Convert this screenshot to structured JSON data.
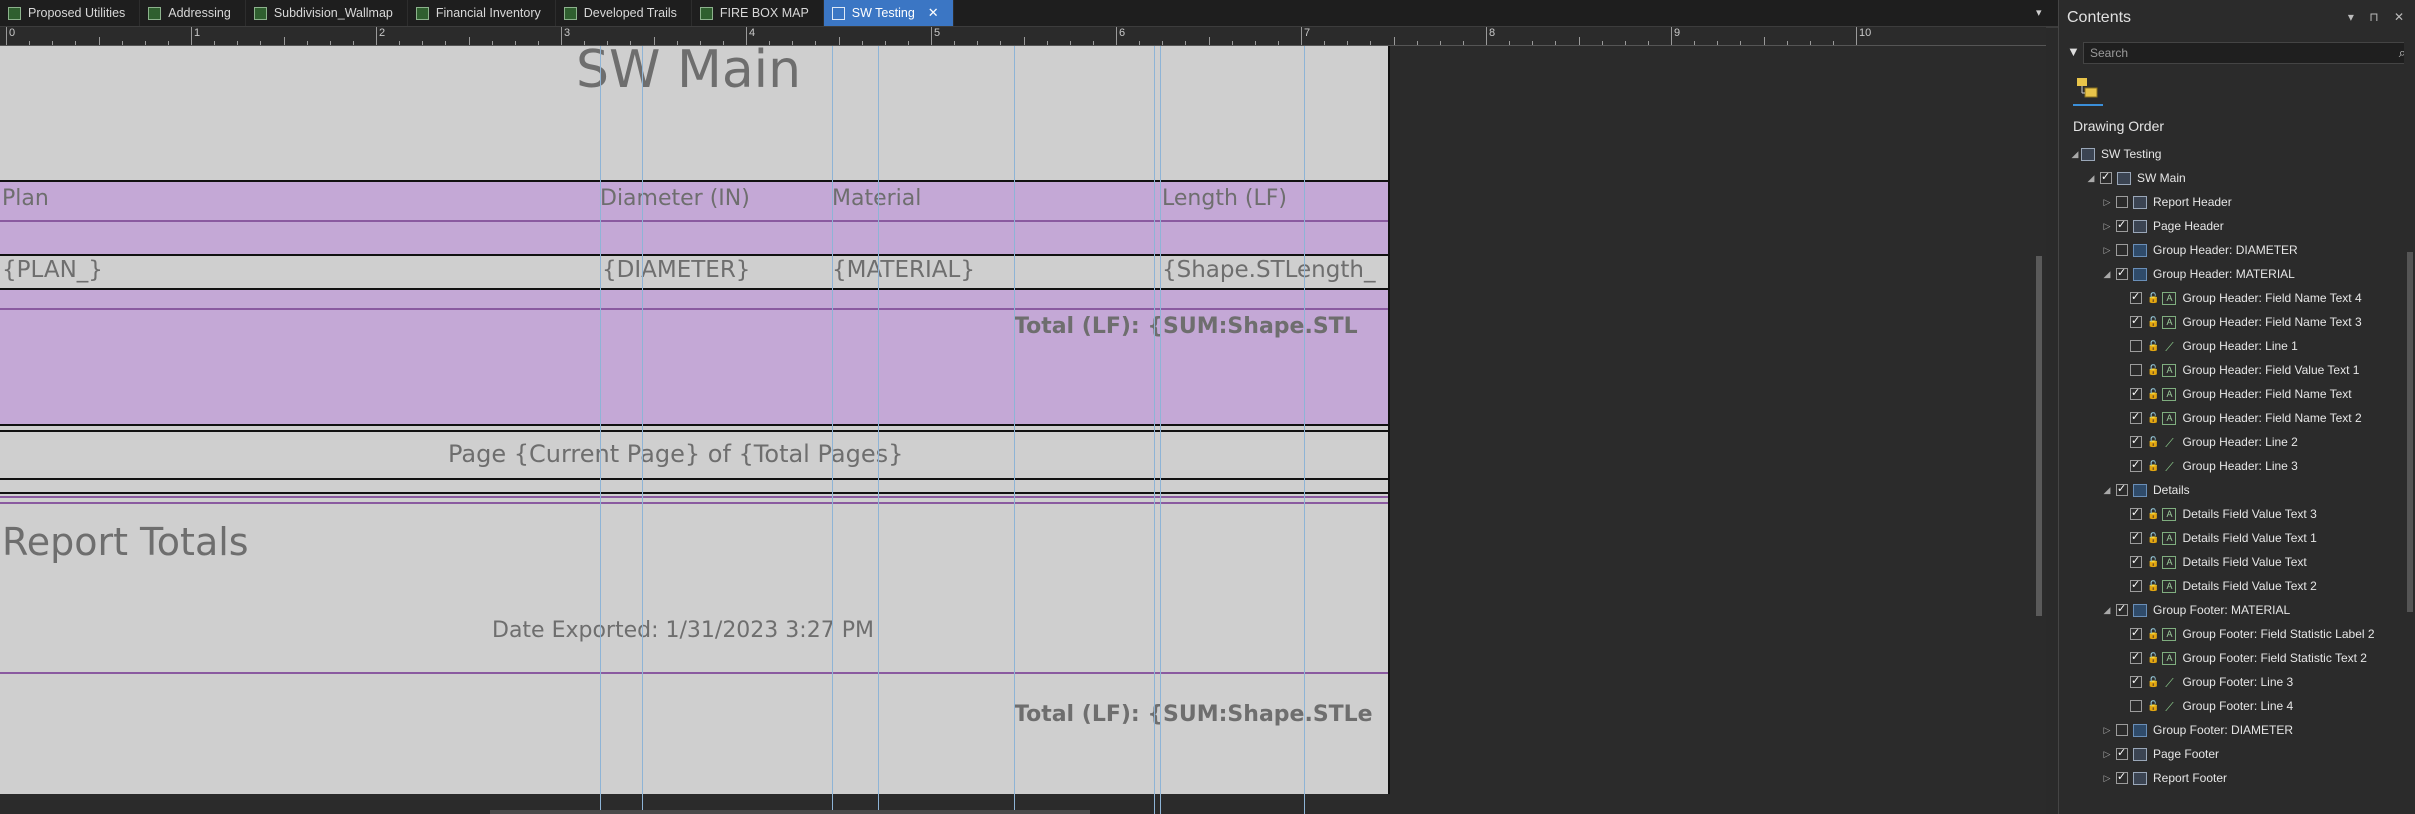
{
  "tabs": [
    {
      "label": "Proposed Utilities",
      "active": false
    },
    {
      "label": "Addressing",
      "active": false
    },
    {
      "label": "Subdivision_Wallmap",
      "active": false
    },
    {
      "label": "Financial Inventory",
      "active": false
    },
    {
      "label": "Developed Trails",
      "active": false
    },
    {
      "label": "FIRE BOX MAP",
      "active": false
    },
    {
      "label": "SW Testing",
      "active": true
    }
  ],
  "tab_close_glyph": "✕",
  "tab_menu_glyph": "▾",
  "ruler_numbers": [
    "0",
    "1",
    "2",
    "3",
    "4",
    "5",
    "6",
    "7",
    "8",
    "9",
    "10"
  ],
  "report": {
    "title": "SW Main",
    "col_plan": "Plan",
    "col_diameter": "Diameter (IN)",
    "col_material": "Material",
    "col_length": "Length (LF)",
    "val_plan": "{PLAN_}",
    "val_diameter": "{DIAMETER}",
    "val_material": "{MATERIAL}",
    "val_length": "{Shape.STLength_",
    "group_total": "Total (LF): {SUM:Shape.STL",
    "page_footer": "Page {Current Page} of {Total Pages}",
    "report_totals": "Report Totals",
    "date_exported": "Date Exported: 1/31/2023 3:27 PM",
    "report_total": "Total (LF): {SUM:Shape.STLe"
  },
  "contents": {
    "title": "Contents",
    "controls": "▾ ⊓ ✕",
    "search_placeholder": "Search",
    "filter_icon": "filter-icon",
    "drawing_order_label": "Drawing Order",
    "tree": [
      {
        "label": "SW Testing",
        "level": 0,
        "expander": "◢",
        "checkbox": null,
        "icon": "doc"
      },
      {
        "label": "SW Main",
        "level": 1,
        "expander": "◢",
        "checkbox": true,
        "icon": "doc"
      },
      {
        "label": "Report Header",
        "level": 2,
        "expander": "▷",
        "checkbox": false,
        "icon": "doc"
      },
      {
        "label": "Page Header",
        "level": 2,
        "expander": "▷",
        "checkbox": true,
        "icon": "doc"
      },
      {
        "label": "Group Header: DIAMETER",
        "level": 2,
        "expander": "▷",
        "checkbox": false,
        "icon": "band"
      },
      {
        "label": "Group Header: MATERIAL",
        "level": 2,
        "expander": "◢",
        "checkbox": true,
        "icon": "band"
      },
      {
        "label": "Group Header:  Field Name Text 4",
        "level": 3,
        "expander": "",
        "checkbox": true,
        "icon": "txt"
      },
      {
        "label": "Group Header:  Field Name Text 3",
        "level": 3,
        "expander": "",
        "checkbox": true,
        "icon": "txt"
      },
      {
        "label": "Group Header:  Line 1",
        "level": 3,
        "expander": "",
        "checkbox": false,
        "icon": "line"
      },
      {
        "label": "Group Header:  Field Value Text 1",
        "level": 3,
        "expander": "",
        "checkbox": false,
        "icon": "txt"
      },
      {
        "label": "Group Header:  Field Name Text",
        "level": 3,
        "expander": "",
        "checkbox": true,
        "icon": "txt"
      },
      {
        "label": "Group Header:  Field Name Text 2",
        "level": 3,
        "expander": "",
        "checkbox": true,
        "icon": "txt"
      },
      {
        "label": "Group Header:  Line 2",
        "level": 3,
        "expander": "",
        "checkbox": true,
        "icon": "line"
      },
      {
        "label": "Group Header:  Line 3",
        "level": 3,
        "expander": "",
        "checkbox": true,
        "icon": "line"
      },
      {
        "label": "Details",
        "level": 2,
        "expander": "◢",
        "checkbox": true,
        "icon": "band"
      },
      {
        "label": "Details Field Value Text 3",
        "level": 3,
        "expander": "",
        "checkbox": true,
        "icon": "txt"
      },
      {
        "label": "Details Field Value Text 1",
        "level": 3,
        "expander": "",
        "checkbox": true,
        "icon": "txt"
      },
      {
        "label": "Details Field Value Text",
        "level": 3,
        "expander": "",
        "checkbox": true,
        "icon": "txt"
      },
      {
        "label": "Details Field Value Text 2",
        "level": 3,
        "expander": "",
        "checkbox": true,
        "icon": "txt"
      },
      {
        "label": "Group Footer: MATERIAL",
        "level": 2,
        "expander": "◢",
        "checkbox": true,
        "icon": "band"
      },
      {
        "label": "Group Footer:  Field Statistic Label 2",
        "level": 3,
        "expander": "",
        "checkbox": true,
        "icon": "txt"
      },
      {
        "label": "Group Footer:  Field Statistic Text 2",
        "level": 3,
        "expander": "",
        "checkbox": true,
        "icon": "txt"
      },
      {
        "label": "Group Footer:  Line 3",
        "level": 3,
        "expander": "",
        "checkbox": true,
        "icon": "line"
      },
      {
        "label": "Group Footer:  Line 4",
        "level": 3,
        "expander": "",
        "checkbox": false,
        "icon": "line"
      },
      {
        "label": "Group Footer: DIAMETER",
        "level": 2,
        "expander": "▷",
        "checkbox": false,
        "icon": "band"
      },
      {
        "label": "Page Footer",
        "level": 2,
        "expander": "▷",
        "checkbox": true,
        "icon": "doc"
      },
      {
        "label": "Report Footer",
        "level": 2,
        "expander": "▷",
        "checkbox": true,
        "icon": "doc"
      }
    ]
  },
  "colors": {
    "accent": "#3b76c4",
    "band_purple": "#c4a8d6",
    "page_gray": "#cfcfcf",
    "text_gray": "#6e6e6e"
  }
}
